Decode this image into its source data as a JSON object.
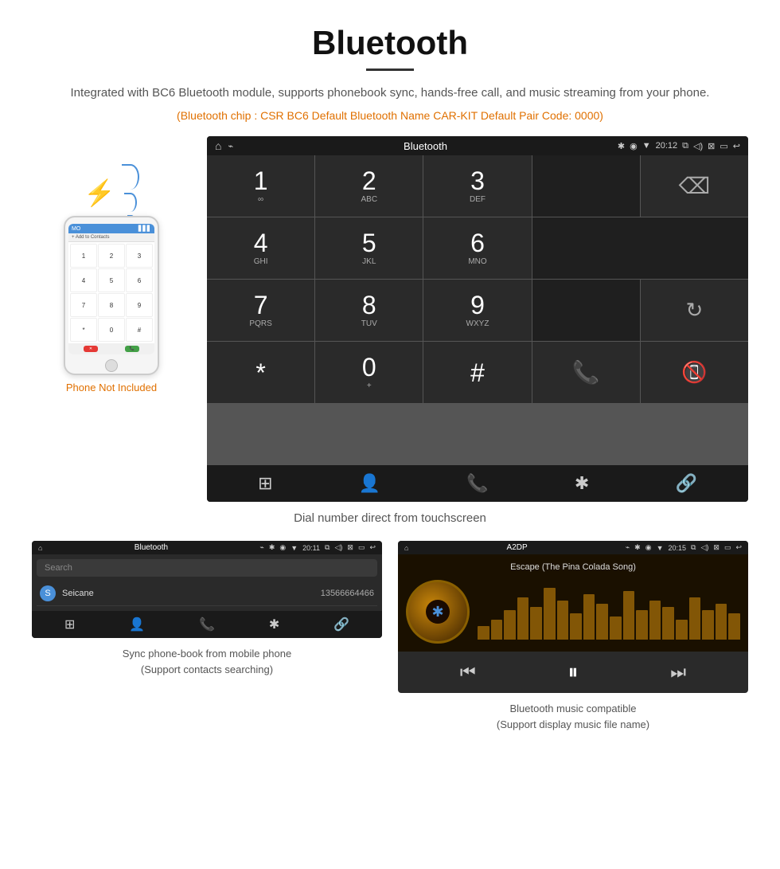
{
  "page": {
    "title": "Bluetooth",
    "subtitle": "Integrated with BC6 Bluetooth module, supports phonebook sync, hands-free call, and music streaming from your phone.",
    "chip_info": "(Bluetooth chip : CSR BC6    Default Bluetooth Name CAR-KIT    Default Pair Code: 0000)",
    "screen_caption": "Dial number direct from touchscreen",
    "phone_not_included": "Phone Not Included"
  },
  "car_screen": {
    "status_bar": {
      "title": "Bluetooth",
      "time": "20:12",
      "usb_icon": "⌁",
      "bt_icon": "✱",
      "loc_icon": "◉",
      "signal_icon": "▼"
    },
    "dialpad": [
      {
        "num": "1",
        "letters": "∞",
        "col": 1,
        "row": 1
      },
      {
        "num": "2",
        "letters": "ABC",
        "col": 2,
        "row": 1
      },
      {
        "num": "3",
        "letters": "DEF",
        "col": 3,
        "row": 1
      },
      {
        "num": "4",
        "letters": "GHI",
        "col": 1,
        "row": 2
      },
      {
        "num": "5",
        "letters": "JKL",
        "col": 2,
        "row": 2
      },
      {
        "num": "6",
        "letters": "MNO",
        "col": 3,
        "row": 2
      },
      {
        "num": "7",
        "letters": "PQRS",
        "col": 1,
        "row": 3
      },
      {
        "num": "8",
        "letters": "TUV",
        "col": 2,
        "row": 3
      },
      {
        "num": "9",
        "letters": "WXYZ",
        "col": 3,
        "row": 3
      },
      {
        "num": "*",
        "letters": "",
        "col": 1,
        "row": 4
      },
      {
        "num": "0",
        "letters": "+",
        "col": 2,
        "row": 4
      },
      {
        "num": "#",
        "letters": "",
        "col": 3,
        "row": 4
      }
    ],
    "bottom_icons": [
      "⊞",
      "👤",
      "📞",
      "✱",
      "🔗"
    ]
  },
  "phonebook_screen": {
    "status_bar": {
      "title": "Bluetooth",
      "time": "20:11"
    },
    "search_placeholder": "Search",
    "contacts": [
      {
        "initial": "S",
        "name": "Seicane",
        "phone": "13566664466"
      }
    ],
    "bottom_icons": [
      "⊞",
      "👤",
      "📞",
      "✱",
      "🔗"
    ]
  },
  "music_screen": {
    "status_bar": {
      "title": "A2DP",
      "time": "20:15"
    },
    "song_title": "Escape (The Pina Colada Song)",
    "eq_bars": [
      3,
      5,
      8,
      12,
      9,
      15,
      11,
      7,
      13,
      10,
      6,
      14,
      8,
      11,
      9,
      5,
      12,
      8,
      10,
      7
    ],
    "controls": [
      "⏮",
      "⏭|",
      "⏭"
    ]
  },
  "captions": {
    "phonebook": "Sync phone-book from mobile phone\n(Support contacts searching)",
    "music": "Bluetooth music compatible\n(Support display music file name)"
  }
}
